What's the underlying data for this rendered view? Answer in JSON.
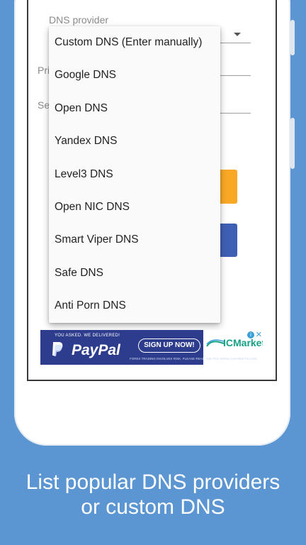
{
  "screen": {
    "dns_provider_label": "DNS provider",
    "primary_label_fragment": "Pri",
    "secondary_label_fragment": "Se"
  },
  "dropdown": {
    "options": [
      "Custom DNS (Enter manually)",
      "Google DNS",
      "Open DNS",
      "Yandex DNS",
      "Level3 DNS",
      "Open NIC DNS",
      "Smart Viper DNS",
      "Safe DNS",
      "Anti Porn DNS"
    ]
  },
  "ad": {
    "tagline": "YOU ASKED. WE DELIVERED!",
    "brand": "PayPal",
    "cta": "SIGN UP NOW!",
    "advertiser": "ICMarkets",
    "disclaimer": "FOREX TRADING INVOLVES RISK. PLEASE READ THE PDS WWW.ICMARKETS.COM",
    "info_glyph": "i",
    "close_glyph": "✕"
  },
  "caption": {
    "line1": "List popular DNS providers",
    "line2": "or custom DNS"
  },
  "colors": {
    "background": "#5b96d2",
    "orange_button": "#f9a825",
    "blue_button": "#3f5fb4",
    "ad_background": "#2d3c8c"
  },
  "icons": [
    "dropdown-caret-icon",
    "paypal-logo-icon",
    "icmarkets-logo-icon",
    "ad-info-icon",
    "ad-close-icon"
  ]
}
